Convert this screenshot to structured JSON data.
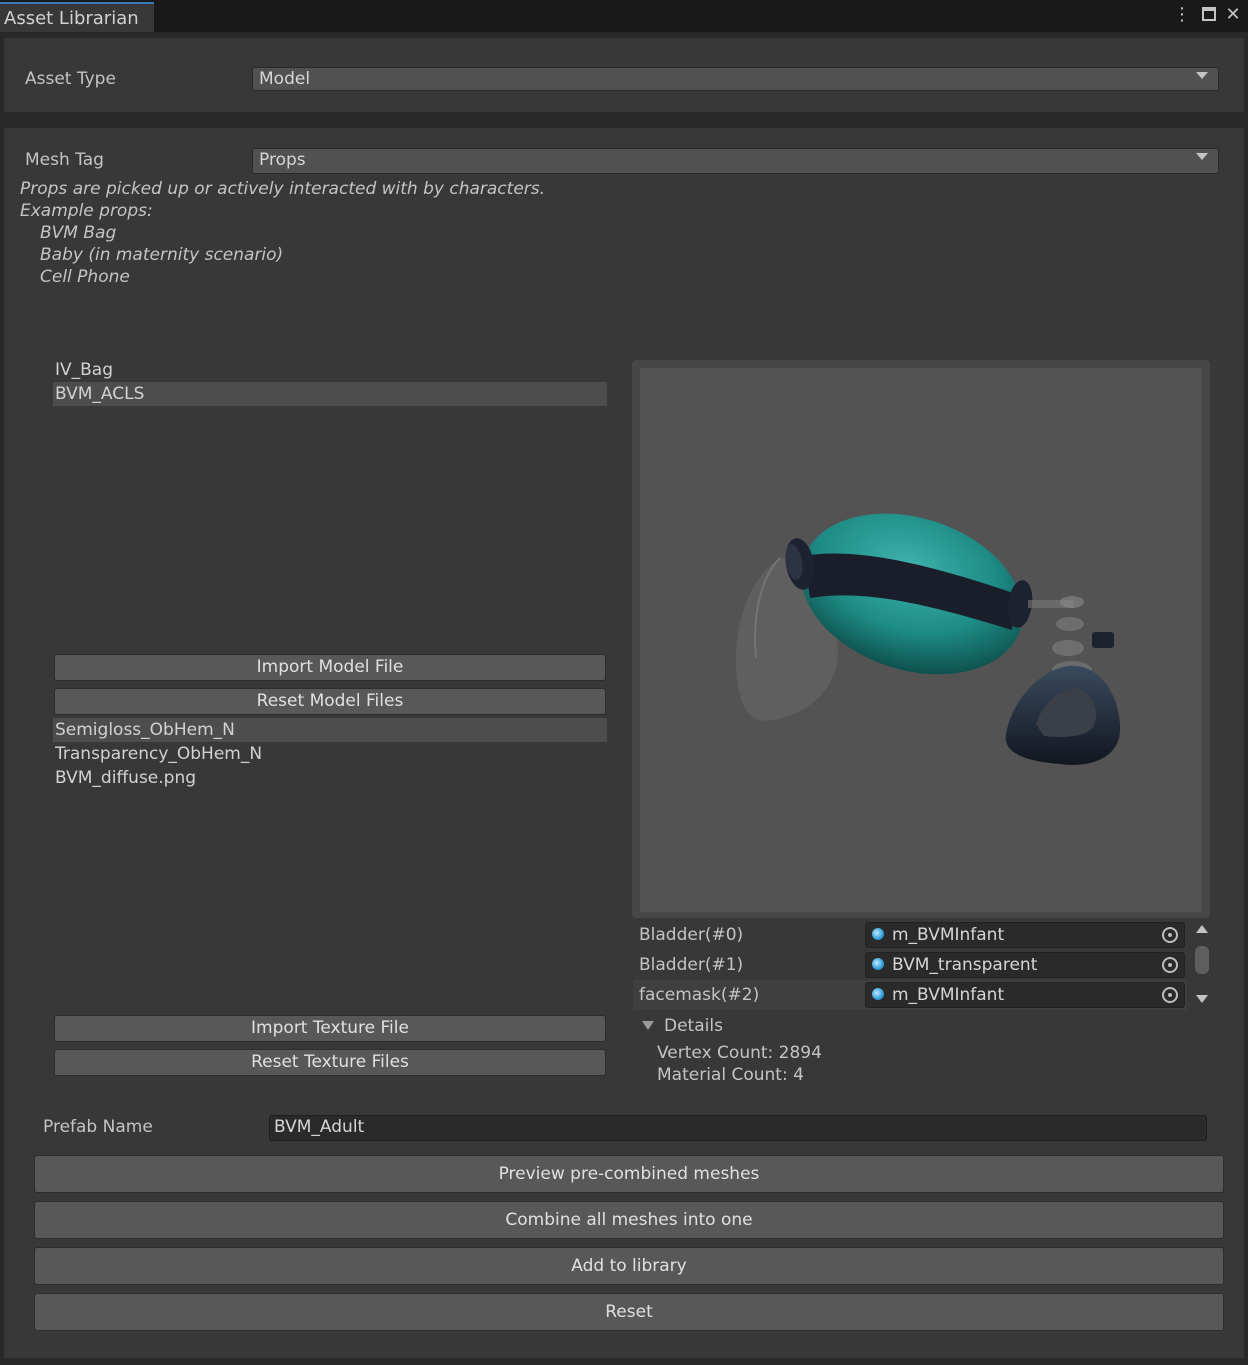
{
  "window": {
    "tab_title": "Asset Librarian",
    "menu_icon": "kebab-menu-icon",
    "maximize_icon": "maximize-icon",
    "close_icon": "close-icon"
  },
  "asset_type": {
    "label": "Asset Type",
    "value": "Model"
  },
  "mesh_tag": {
    "label": "Mesh Tag",
    "value": "Props",
    "description": [
      "Props are picked up or actively interacted with by characters.",
      "Example props:",
      "BVM Bag",
      "Baby (in maternity scenario)",
      "Cell Phone"
    ]
  },
  "model_list": {
    "items": [
      "IV_Bag",
      "BVM_ACLS"
    ],
    "selected": "BVM_ACLS"
  },
  "buttons": {
    "import_model": "Import Model File",
    "reset_model": "Reset Model Files",
    "import_texture": "Import Texture File",
    "reset_texture": "Reset Texture Files"
  },
  "texture_list": {
    "items": [
      "Semigloss_ObHem_N",
      "Transparency_ObHem_N",
      "BVM_diffuse.png"
    ],
    "selected": "Semigloss_ObHem_N"
  },
  "materials": [
    {
      "slot": "Bladder(#0)",
      "material": "m_BVMInfant"
    },
    {
      "slot": "Bladder(#1)",
      "material": "BVM_transparent"
    },
    {
      "slot": "facemask(#2)",
      "material": "m_BVMInfant"
    }
  ],
  "details": {
    "header": "Details",
    "vertex_count": "Vertex Count: 2894",
    "material_count": "Material Count: 4"
  },
  "prefab": {
    "label": "Prefab Name",
    "value": "BVM_Adult"
  },
  "actions": {
    "preview": "Preview pre-combined meshes",
    "combine": "Combine all meshes into one",
    "add": "Add to library",
    "reset": "Reset"
  },
  "colors": {
    "accent": "#3a79bb",
    "bladder": "#1e8d86",
    "dark_part": "#1a1e2a"
  }
}
